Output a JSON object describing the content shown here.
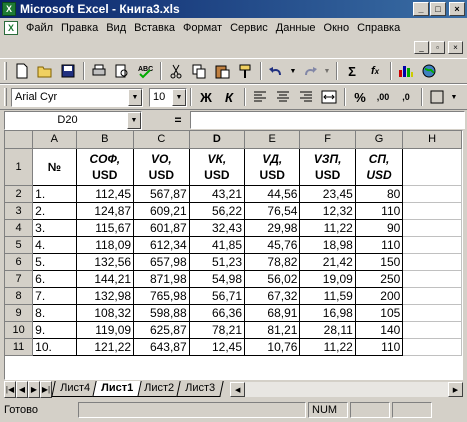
{
  "title_bar": {
    "title": "Microsoft Excel - Книга3.xls",
    "min": "_",
    "max": "□",
    "close": "×"
  },
  "menu": [
    "Файл",
    "Правка",
    "Вид",
    "Вставка",
    "Формат",
    "Сервис",
    "Данные",
    "Окно",
    "Справка"
  ],
  "doc_controls": {
    "min": "_",
    "restore": "▫",
    "close": "×"
  },
  "format_toolbar": {
    "font": "Arial Cyr",
    "size": "10",
    "bold": "Ж",
    "italic": "К"
  },
  "formula_bar": {
    "name_box": "D20",
    "equals": "="
  },
  "columns": [
    "A",
    "B",
    "C",
    "D",
    "E",
    "F",
    "G",
    "H"
  ],
  "active_column": "D",
  "header_row": {
    "row_num": "1",
    "cells": [
      {
        "line1": "№",
        "line2": ""
      },
      {
        "line1": "СОФ,",
        "line2": "USD"
      },
      {
        "line1": "VО,",
        "line2": "USD"
      },
      {
        "line1": "VК,",
        "line2": "USD"
      },
      {
        "line1": "VД,",
        "line2": "USD"
      },
      {
        "line1": "VЗП,",
        "line2": "USD"
      },
      {
        "line1": "СП,",
        "line2": "USD"
      }
    ]
  },
  "rows": [
    {
      "n": "2",
      "cells": [
        "1.",
        "112,45",
        "567,87",
        "43,21",
        "44,56",
        "23,45",
        "80"
      ]
    },
    {
      "n": "3",
      "cells": [
        "2.",
        "124,87",
        "609,21",
        "56,22",
        "76,54",
        "12,32",
        "110"
      ]
    },
    {
      "n": "4",
      "cells": [
        "3.",
        "115,67",
        "601,87",
        "32,43",
        "29,98",
        "11,22",
        "90"
      ]
    },
    {
      "n": "5",
      "cells": [
        "4.",
        "118,09",
        "612,34",
        "41,85",
        "45,76",
        "18,98",
        "110"
      ]
    },
    {
      "n": "6",
      "cells": [
        "5.",
        "132,56",
        "657,98",
        "51,23",
        "78,82",
        "21,42",
        "150"
      ]
    },
    {
      "n": "7",
      "cells": [
        "6.",
        "144,21",
        "871,98",
        "54,98",
        "56,02",
        "19,09",
        "250"
      ]
    },
    {
      "n": "8",
      "cells": [
        "7.",
        "132,98",
        "765,98",
        "56,71",
        "67,32",
        "11,59",
        "200"
      ]
    },
    {
      "n": "9",
      "cells": [
        "8.",
        "108,32",
        "598,88",
        "66,36",
        "68,91",
        "16,98",
        "105"
      ]
    },
    {
      "n": "10",
      "cells": [
        "9.",
        "119,09",
        "625,87",
        "78,21",
        "81,21",
        "28,11",
        "140"
      ]
    },
    {
      "n": "11",
      "cells": [
        "10.",
        "121,22",
        "643,87",
        "12,45",
        "10,76",
        "11,22",
        "110"
      ]
    }
  ],
  "sheet_tabs": [
    "Лист4",
    "Лист1",
    "Лист2",
    "Лист3"
  ],
  "active_sheet": "Лист1",
  "status": {
    "ready": "Готово",
    "num": "NUM"
  }
}
